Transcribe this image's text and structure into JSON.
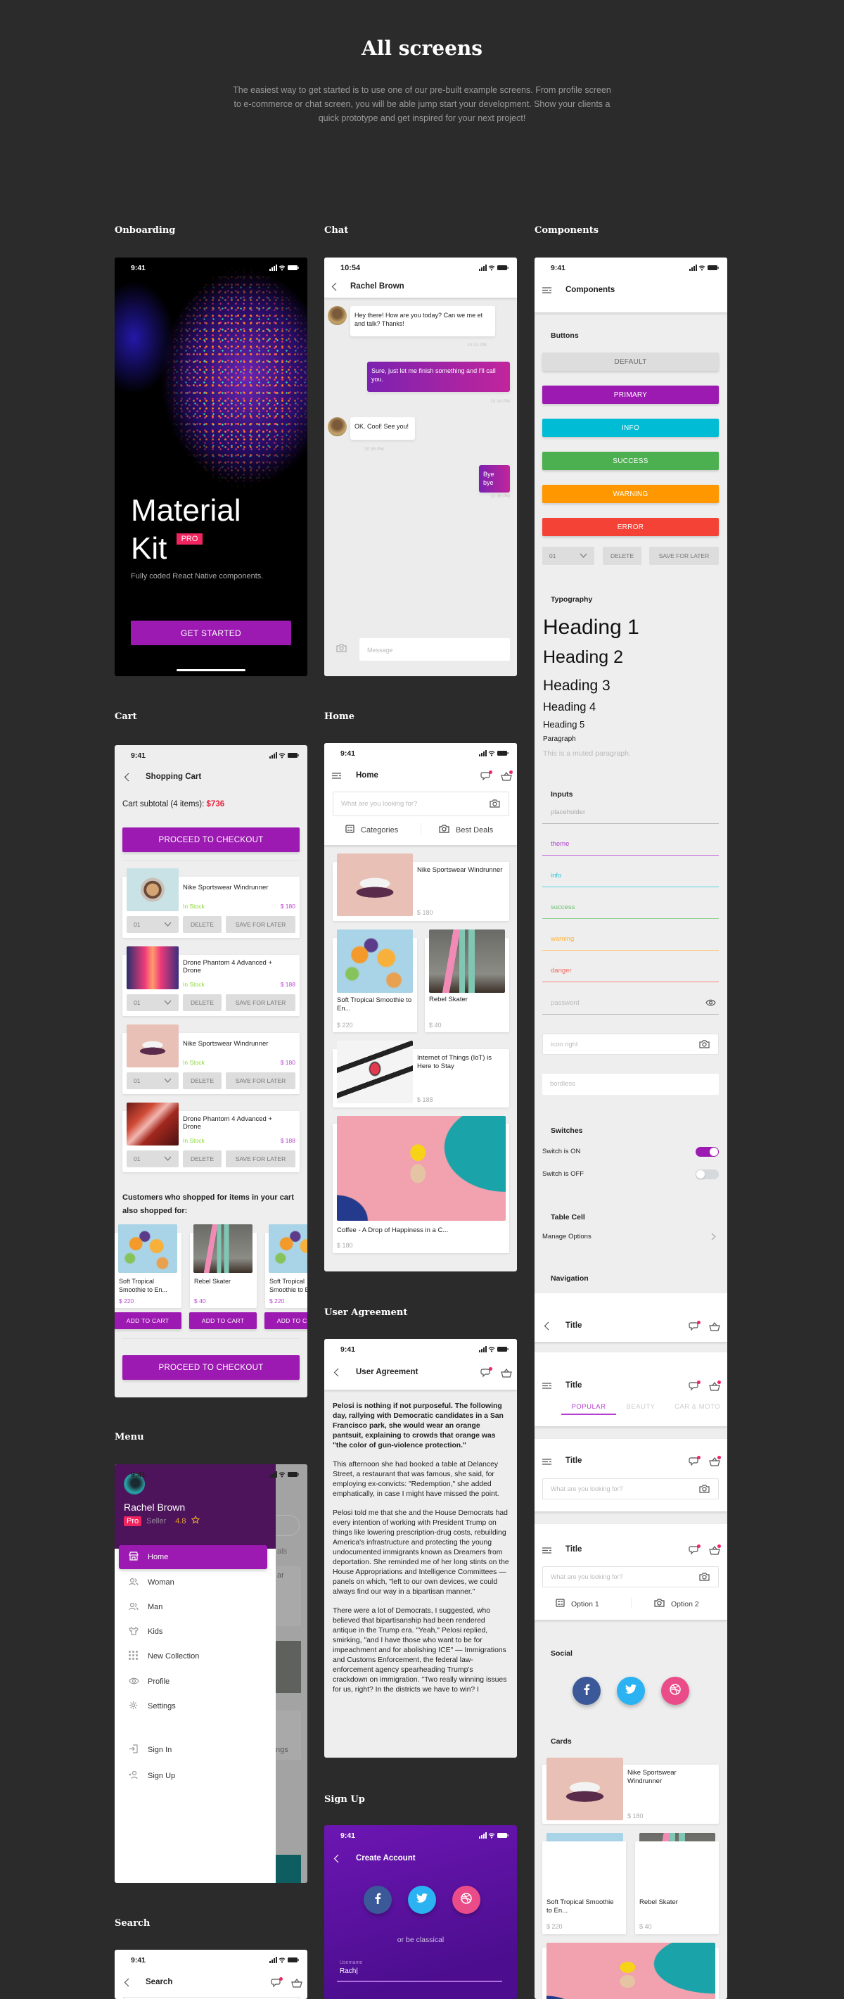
{
  "page": {
    "title": "All screens",
    "description": "The easiest way to get started is to use one of our pre-built example screens. From profile screen to e-commerce or chat screen, you will be able jump start your development. Show your clients a quick prototype and get inspired for your next project!"
  },
  "sections": {
    "onboarding": "Onboarding",
    "chat": "Chat",
    "components": "Components",
    "cart": "Cart",
    "home": "Home",
    "user_agreement": "User Agreement",
    "menu": "Menu",
    "sign_up": "Sign Up",
    "search": "Search"
  },
  "colors": {
    "background": "#2b2b2b",
    "primary": "#9c1ab1",
    "info": "#00bcd4",
    "success": "#4caf50",
    "warning": "#ff9800",
    "error": "#f44336",
    "pro_badge": "#f0245f",
    "facebook": "#3b5998",
    "twitter": "#2ab2f2",
    "dribbble": "#ea4c89"
  },
  "onboarding": {
    "time": "9:41",
    "title_line1": "Material",
    "title_line2": "Kit",
    "badge": "PRO",
    "subtitle": "Fully coded React Native components.",
    "button": "GET STARTED"
  },
  "chat": {
    "time": "10:54",
    "contact": "Rachel Brown",
    "messages": [
      {
        "from": "them",
        "text": "Hey there! How are you today? Can we me et and talk? Thanks!",
        "time": "10:31 PM"
      },
      {
        "from": "me",
        "text": "Sure, just let me finish something and I'll call you.",
        "time": "10:34 PM"
      },
      {
        "from": "them",
        "text": "OK. Cool! See you!",
        "time": "10:35 PM"
      },
      {
        "from": "me",
        "text": "Bye bye",
        "time": "10:36 PM"
      }
    ],
    "input_placeholder": "Message"
  },
  "components": {
    "time": "9:41",
    "title": "Components",
    "buttons_heading": "Buttons",
    "buttons": [
      {
        "label": "DEFAULT",
        "color": "#dddddd",
        "text_color": "#666666"
      },
      {
        "label": "PRIMARY",
        "color": "#9c1ab1",
        "text_color": "#ffffff"
      },
      {
        "label": "INFO",
        "color": "#00bcd4",
        "text_color": "#ffffff"
      },
      {
        "label": "SUCCESS",
        "color": "#4caf50",
        "text_color": "#ffffff"
      },
      {
        "label": "WARNING",
        "color": "#ff9800",
        "text_color": "#ffffff"
      },
      {
        "label": "ERROR",
        "color": "#f44336",
        "text_color": "#ffffff"
      }
    ],
    "quantity": "01",
    "delete": "DELETE",
    "save_for_later": "SAVE FOR LATER",
    "typography_heading": "Typography",
    "typography": [
      "Heading 1",
      "Heading 2",
      "Heading 3",
      "Heading 4",
      "Heading 5",
      "Paragraph"
    ],
    "muted_paragraph": "This is a muted paragraph.",
    "inputs_heading": "Inputs",
    "inputs": [
      {
        "placeholder": "placeholder",
        "color": "#aaaaaa",
        "line": "#b9b9b9"
      },
      {
        "placeholder": "theme",
        "color": "#b23fce",
        "line": "#c36ed8"
      },
      {
        "placeholder": "info",
        "color": "#2ec3d8",
        "line": "#55d3e4"
      },
      {
        "placeholder": "success",
        "color": "#6cc070",
        "line": "#8ccf8f"
      },
      {
        "placeholder": "warning",
        "color": "#ffb13b",
        "line": "#ffc068"
      },
      {
        "placeholder": "danger",
        "color": "#f26a60",
        "line": "#f58a82"
      }
    ],
    "password_placeholder": "password",
    "icon_right_placeholder": "icon right",
    "borderless_placeholder": "bordless",
    "switches_heading": "Switches",
    "switch_on_label": "Switch is ON",
    "switch_off_label": "Switch is OFF",
    "switch_on": true,
    "switch_off": false,
    "table_cell_heading": "Table Cell",
    "table_cell_label": "Manage Options",
    "navigation_heading": "Navigation",
    "nav_title": "Title",
    "nav_tabs": [
      "POPULAR",
      "BEAUTY",
      "CAR & MOTO"
    ],
    "search_placeholder": "What are you looking for?",
    "option_1": "Option 1",
    "option_2": "Option 2",
    "social_heading": "Social",
    "cards_heading": "Cards",
    "cards": [
      {
        "title": "Nike Sportswear Windrunner",
        "price": "$ 180"
      },
      {
        "title": "Soft Tropical Smoothie to En...",
        "price": "$ 220"
      },
      {
        "title": "Rebel Skater",
        "price": "$ 40"
      }
    ]
  },
  "cart": {
    "time": "9:41",
    "title": "Shopping Cart",
    "subtotal_label": "Cart subtotal (4 items):",
    "subtotal_value": "$736",
    "checkout": "PROCEED TO CHECKOUT",
    "items": [
      {
        "title": "Nike Sportswear Windrunner",
        "stock": "In Stock",
        "price": "$ 180",
        "qty": "01"
      },
      {
        "title": "Drone Phantom 4 Advanced + Drone",
        "stock": "In Stock",
        "price": "$ 188",
        "qty": "01"
      },
      {
        "title": "Nike Sportswear Windrunner",
        "stock": "In Stock",
        "price": "$ 180",
        "qty": "01"
      },
      {
        "title": "Drone Phantom 4 Advanced + Drone",
        "stock": "In Stock",
        "price": "$ 188",
        "qty": "01"
      }
    ],
    "delete": "DELETE",
    "save_for_later": "SAVE FOR LATER",
    "also_heading": "Customers who shopped for items in your cart also shopped for:",
    "recommendations": [
      {
        "title": "Soft Tropical Smoothie to En...",
        "price": "$ 220"
      },
      {
        "title": "Rebel Skater",
        "price": "$ 40"
      },
      {
        "title": "Soft Tropical Smoothie to En...",
        "price": "$ 220"
      }
    ],
    "add_to_cart": "ADD TO CART"
  },
  "home": {
    "time": "9:41",
    "title": "Home",
    "search_placeholder": "What are you looking for?",
    "tab_categories": "Categories",
    "tab_best_deals": "Best Deals",
    "products": [
      {
        "title": "Nike Sportswear Windrunner",
        "price": "$ 180"
      },
      {
        "title": "Soft Tropical Smoothie to En...",
        "price": "$ 220"
      },
      {
        "title": "Rebel Skater",
        "price": "$ 40"
      },
      {
        "title": "Internet of Things (IoT) is Here to Stay",
        "price": "$ 188"
      },
      {
        "title": "Coffee - A Drop of Happiness in a C...",
        "price": "$ 180"
      }
    ]
  },
  "user_agreement": {
    "time": "9:41",
    "title": "User Agreement",
    "lead": "Pelosi is nothing if not purposeful. The following day, rallying with Democratic candidates in a San Francisco park, she would wear an orange pantsuit, explaining to crowds that orange was \"the color of gun-violence protection.\"",
    "paragraphs": [
      "This afternoon she had booked a table at Delancey Street, a restaurant that was famous, she said, for employing ex-convicts: \"Redemption,\" she added emphatically, in case I might have missed the point.",
      "Pelosi told me that she and the House Democrats had every intention of working with President Trump on things like lowering prescription-drug costs, rebuilding America's infrastructure and protecting the young undocumented immigrants known as Dreamers from deportation. She reminded me of her long stints on the House Appropriations and Intelligence Committees — panels on which, \"left to our own devices, we could always find our way in a bipartisan manner.\"",
      "There were a lot of Democrats, I suggested, who believed that bipartisanship had been rendered antique in the Trump era. \"Yeah,\" Pelosi replied, smirking, \"and I have those who want to be for impeachment and for abolishing ICE\" — Immigrations and Customs Enforcement, the federal law-enforcement agency spearheading Trump's crackdown on immigration. \"Two really winning issues for us, right? In the districts we have to win? I"
    ]
  },
  "menu": {
    "time": "9:41",
    "user_name": "Rachel Brown",
    "badge": "Pro",
    "role": "Seller",
    "rating": "4.8",
    "items": [
      {
        "label": "Home",
        "icon": "shop",
        "active": true
      },
      {
        "label": "Woman",
        "icon": "users",
        "active": false
      },
      {
        "label": "Man",
        "icon": "users",
        "active": false
      },
      {
        "label": "Kids",
        "icon": "shirt",
        "active": false
      },
      {
        "label": "New Collection",
        "icon": "grid",
        "active": false
      },
      {
        "label": "Profile",
        "icon": "eye",
        "active": false
      },
      {
        "label": "Settings",
        "icon": "gear",
        "active": false
      }
    ],
    "secondary_items": [
      {
        "label": "Sign In",
        "icon": "sign-in"
      },
      {
        "label": "Sign Up",
        "icon": "add-user"
      }
    ],
    "background_fragments": [
      "als",
      "ar",
      "ngs"
    ]
  },
  "sign_up": {
    "time": "9:41",
    "title": "Create Account",
    "divider_text": "or be classical",
    "username_label": "Username",
    "username_value": "Rach|"
  },
  "search": {
    "time": "9:41",
    "title": "Search"
  }
}
